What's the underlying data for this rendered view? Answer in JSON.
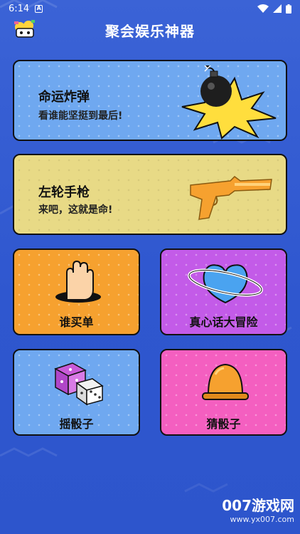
{
  "status": {
    "time": "6:14"
  },
  "header": {
    "title": "聚会娱乐神器"
  },
  "cards": {
    "fate_bomb": {
      "title": "命运炸弹",
      "subtitle": "看谁能坚挺到最后!"
    },
    "revolver": {
      "title": "左轮手枪",
      "subtitle": "来吧，这就是命!"
    },
    "who_pays": {
      "label": "谁买单"
    },
    "truth_dare": {
      "label": "真心话大冒险"
    },
    "shake_dice": {
      "label": "摇骰子"
    },
    "guess_dice": {
      "label": "猜骰子"
    }
  },
  "colors": {
    "background": "#3058d0",
    "fate_bomb": "#6fa8f0",
    "revolver": "#e8da86",
    "who_pays": "#f6a12f",
    "truth_dare": "#c35be8",
    "shake_dice": "#6fa8f0",
    "guess_dice": "#f45fc0"
  },
  "icons": {
    "app": "party-app-icon",
    "bomb": "bomb-explosion-icon",
    "gun": "toy-gun-icon",
    "hand": "hand-in-hole-icon",
    "planet": "heart-planet-icon",
    "dice": "dice-icon",
    "cup": "dice-cup-icon"
  },
  "watermark": {
    "brand": "007游戏网",
    "url": "www.yx007.com"
  }
}
